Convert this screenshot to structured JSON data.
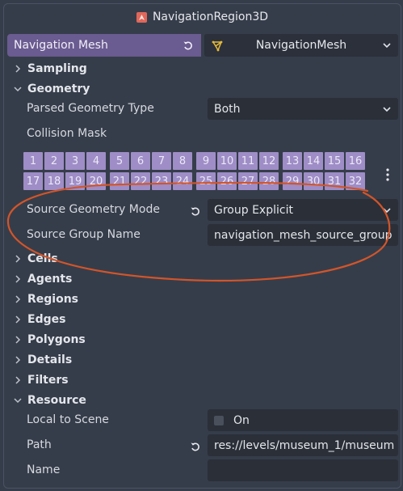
{
  "window": {
    "node_title": "NavigationRegion3D"
  },
  "property": {
    "label": "Navigation Mesh",
    "resource_name": "NavigationMesh"
  },
  "sections": {
    "sampling": "Sampling",
    "geometry": "Geometry",
    "cells": "Cells",
    "agents": "Agents",
    "regions": "Regions",
    "edges": "Edges",
    "polygons": "Polygons",
    "details": "Details",
    "filters": "Filters",
    "resource": "Resource"
  },
  "geometry": {
    "parsed_geometry_type_label": "Parsed Geometry Type",
    "parsed_geometry_type_value": "Both",
    "collision_mask_label": "Collision Mask",
    "collision_mask_layers": [
      "1",
      "2",
      "3",
      "4",
      "5",
      "6",
      "7",
      "8",
      "9",
      "10",
      "11",
      "12",
      "13",
      "14",
      "15",
      "16",
      "17",
      "18",
      "19",
      "20",
      "21",
      "22",
      "23",
      "24",
      "25",
      "26",
      "27",
      "28",
      "29",
      "30",
      "31",
      "32"
    ],
    "source_geometry_mode_label": "Source Geometry Mode",
    "source_geometry_mode_value": "Group Explicit",
    "source_group_name_label": "Source Group Name",
    "source_group_name_value": "navigation_mesh_source_group"
  },
  "resource": {
    "local_to_scene_label": "Local to Scene",
    "local_to_scene_value": "On",
    "path_label": "Path",
    "path_value": "res://levels/museum_1/museum",
    "name_label": "Name",
    "name_value": ""
  },
  "colors": {
    "accent": "#6a5b90",
    "mask_cell": "#9e8dc6",
    "annotation": "#d2552a",
    "background": "#363d4a"
  },
  "icons": {
    "node": "navigation-region-icon",
    "resource": "navigation-mesh-icon",
    "revert": "revert-icon",
    "expand": "chevron-down-icon",
    "collapse": "chevron-right-icon",
    "more": "vertical-dots-icon"
  }
}
